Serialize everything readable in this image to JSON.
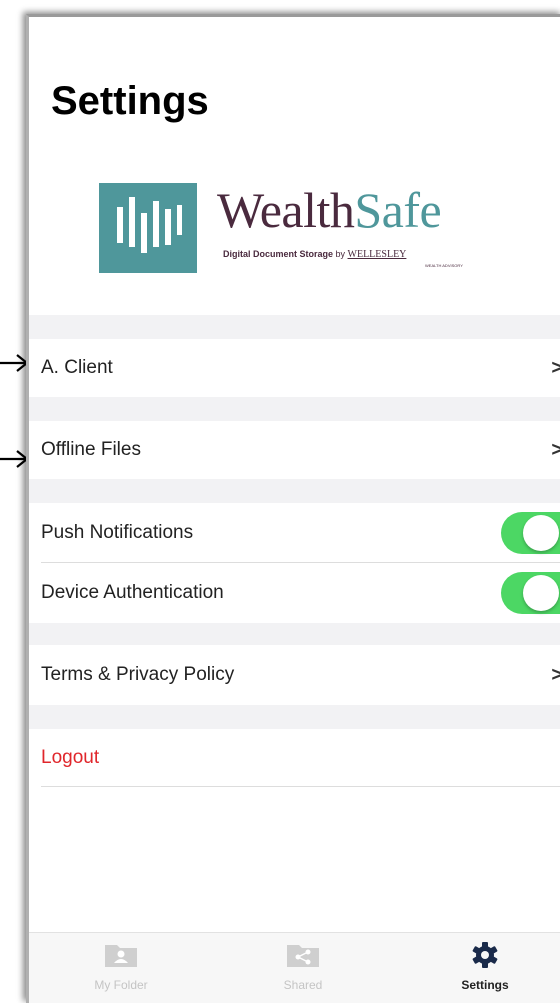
{
  "page": {
    "title": "Settings"
  },
  "logo": {
    "name_part1": "Wealth",
    "name_part2": "Safe",
    "tagline": "Digital Document Storage",
    "tagline_by": " by ",
    "tagline_brand": "WELLESLEY",
    "sub_text": "WEALTH ADVISORY",
    "icon": "bar-chart-logo-icon",
    "colors": {
      "teal": "#4f979b",
      "plum": "#4a2a3e"
    }
  },
  "settings": {
    "account_label": "A. Client",
    "offline_files_label": "Offline Files",
    "push_notifications_label": "Push Notifications",
    "push_notifications_on": true,
    "device_authentication_label": "Device Authentication",
    "device_authentication_on": true,
    "terms_label": "Terms & Privacy Policy",
    "logout_label": "Logout",
    "chevron": ">"
  },
  "tabs": [
    {
      "label": "My Folder",
      "icon": "folder-user-icon",
      "active": false
    },
    {
      "label": "Shared",
      "icon": "share-icon",
      "active": false
    },
    {
      "label": "Settings",
      "icon": "gear-icon",
      "active": true
    }
  ],
  "colors": {
    "toggle_on": "#4cd764",
    "logout": "#e0262b",
    "section_gap": "#f2f2f4"
  },
  "annotations": {
    "arrow_icon": "right-arrow-icon"
  }
}
